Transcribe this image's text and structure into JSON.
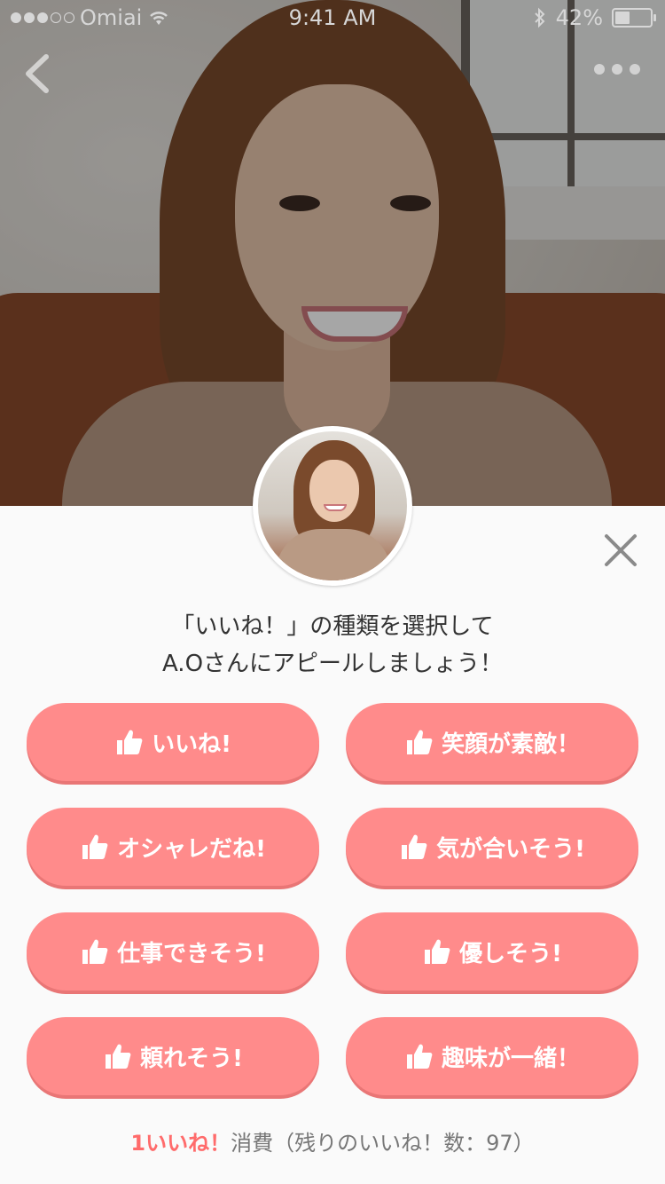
{
  "status_bar": {
    "carrier": "Omiai",
    "time": "9:41 AM",
    "battery": "42%",
    "signal_bars": 3,
    "battery_level": 0.42
  },
  "header": {
    "back_icon": "chevron-left-icon",
    "more_icon": "ellipsis-icon"
  },
  "dialog": {
    "prompt_line1": "「いいね！」の種類を選択して",
    "prompt_line2": "A.Oさんにアピールしましょう！",
    "close_icon": "close-icon",
    "buttons": [
      {
        "label": "いいね!"
      },
      {
        "label": "笑顔が素敵！"
      },
      {
        "label": "オシャレだね!"
      },
      {
        "label": "気が合いそう!"
      },
      {
        "label": "仕事できそう!"
      },
      {
        "label": "優しそう!"
      },
      {
        "label": "頼れそう!"
      },
      {
        "label": "趣味が一緒！"
      }
    ],
    "footer_cost": "1いいね！",
    "footer_text": "消費（残りのいいね！数：97）"
  },
  "colors": {
    "button": "#ff8b8b",
    "button_shadow": "#e97676",
    "accent": "#ff6b6b"
  }
}
